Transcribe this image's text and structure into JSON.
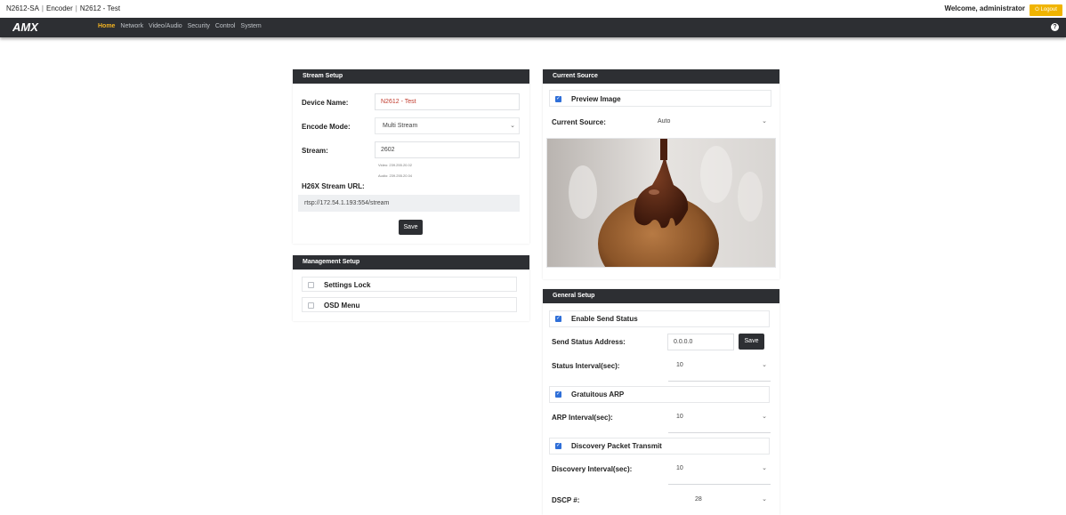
{
  "breadcrumb": {
    "device": "N2612-SA",
    "role": "Encoder",
    "name": "N2612 - Test"
  },
  "header": {
    "welcome": "Welcome, administrator",
    "logout_label": "Logout"
  },
  "navbar": {
    "logo_text": "AMX",
    "items": [
      "Home",
      "Network",
      "Video/Audio",
      "Security",
      "Control",
      "System"
    ],
    "active": "Home",
    "help_icon": "question-circle-icon"
  },
  "stream_setup": {
    "title": "Stream Setup",
    "device_name_label": "Device Name:",
    "device_name_value": "N2612 - Test",
    "encode_mode_label": "Encode Mode:",
    "encode_mode_value": "Multi Stream",
    "stream_label": "Stream:",
    "stream_value": "2602",
    "video_note": "Video: 239.255.20.02",
    "audio_note": "Audio: 239.255.20.04",
    "url_label": "H26X Stream URL:",
    "url_value": "rtsp://172.54.1.193:554/stream",
    "save_label": "Save"
  },
  "management_setup": {
    "title": "Management Setup",
    "items": [
      {
        "label": "Settings Lock",
        "checked": false
      },
      {
        "label": "OSD Menu",
        "checked": false
      }
    ]
  },
  "current_source": {
    "title": "Current Source",
    "preview_label": "Preview Image",
    "preview_checked": true,
    "source_label": "Current Source:",
    "source_value": "Auto"
  },
  "general_setup": {
    "title": "General Setup",
    "enable_send_status": "Enable Send Status",
    "send_status_address_label": "Send Status Address:",
    "send_status_address_value": "0.0.0.0",
    "save_label": "Save",
    "status_interval_label": "Status Interval(sec):",
    "status_interval_value": "10",
    "gratuitous_arp": "Gratuitous ARP",
    "arp_interval_label": "ARP Interval(sec):",
    "arp_interval_value": "10",
    "discovery_packet": "Discovery Packet Transmit",
    "discovery_interval_label": "Discovery Interval(sec):",
    "discovery_interval_value": "10",
    "dscp_label": "DSCP #:",
    "dscp_value": "28"
  },
  "colors": {
    "accent": "#f3b321",
    "nav_bg": "#2d2f33",
    "checkbox": "#2f6fd8"
  }
}
